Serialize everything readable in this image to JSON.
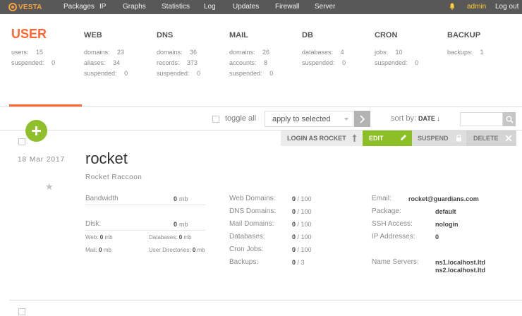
{
  "nav": {
    "brand": "VESTA",
    "items": [
      "Packages",
      "IP",
      "Graphs",
      "Statistics",
      "Log",
      "Updates",
      "Firewall",
      "Server"
    ],
    "user": "admin",
    "logout": "Log out"
  },
  "summary": {
    "user": {
      "title": "USER",
      "stats": [
        [
          "users:",
          "15"
        ],
        [
          "suspended:",
          "0"
        ]
      ]
    },
    "web": {
      "title": "WEB",
      "stats": [
        [
          "domains:",
          "23"
        ],
        [
          "aliases:",
          "34"
        ],
        [
          "suspended:",
          "0"
        ]
      ]
    },
    "dns": {
      "title": "DNS",
      "stats": [
        [
          "domains:",
          "36"
        ],
        [
          "records:",
          "373"
        ],
        [
          "suspended:",
          "0"
        ]
      ]
    },
    "mail": {
      "title": "MAIL",
      "stats": [
        [
          "domains:",
          "26"
        ],
        [
          "accounts:",
          "8"
        ],
        [
          "suspended:",
          "0"
        ]
      ]
    },
    "db": {
      "title": "DB",
      "stats": [
        [
          "databases:",
          "4"
        ],
        [
          "suspended:",
          "0"
        ]
      ]
    },
    "cron": {
      "title": "CRON",
      "stats": [
        [
          "jobs:",
          "10"
        ],
        [
          "suspended:",
          "0"
        ]
      ]
    },
    "backup": {
      "title": "BACKUP",
      "stats": [
        [
          "backups:",
          "1"
        ]
      ]
    }
  },
  "toolbar": {
    "toggle_all": "toggle all",
    "apply_selected": "apply to selected",
    "sort_by": "sort by:",
    "sort_value": "DATE ↓",
    "search_placeholder": ""
  },
  "actions": {
    "login_as": "LOGIN AS ROCKET",
    "edit": "EDIT",
    "suspend": "SUSPEND",
    "delete": "DELETE"
  },
  "record": {
    "date": "18 Mar 2017",
    "username": "rocket",
    "fullname": "Rocket Raccoon",
    "bandwidth_label": "Bandwidth",
    "bandwidth_value": "0",
    "bandwidth_unit": "mb",
    "disk_label": "Disk:",
    "disk_value": "0",
    "disk_unit": "mb",
    "web_label": "Web:",
    "web_value": "0",
    "web_unit": "mb",
    "databases_label": "Databases:",
    "databases_value": "0",
    "databases_unit": "mb",
    "mail_label": "Mail:",
    "mail_value": "0",
    "mail_unit": "mb",
    "userdirs_label": "User Directories:",
    "userdirs_value": "0",
    "userdirs_unit": "mb",
    "usage": [
      {
        "label": "Web Domains:",
        "used": "0",
        "limit": "/ 100"
      },
      {
        "label": "DNS Domains:",
        "used": "0",
        "limit": "/ 100"
      },
      {
        "label": "Mail Domains:",
        "used": "0",
        "limit": "/ 100"
      },
      {
        "label": "Databases:",
        "used": "0",
        "limit": "/ 100"
      },
      {
        "label": "Cron Jobs:",
        "used": "0",
        "limit": "/ 100"
      },
      {
        "label": "Backups:",
        "used": "0",
        "limit": "/ 3"
      }
    ],
    "info": [
      {
        "label": "Email:",
        "value": "rocket@guardians.com"
      },
      {
        "label": "Package:",
        "value": "default"
      },
      {
        "label": "SSH Access:",
        "value": "nologin"
      },
      {
        "label": "IP Addresses:",
        "value": "0"
      }
    ],
    "ns_label": "Name Servers:",
    "ns1": "ns1.localhost.ltd",
    "ns2": "ns2.localhost.ltd"
  },
  "colors": {
    "accent": "#ff6633",
    "edit_green": "#8cbf26",
    "add_green": "#8fc02c",
    "nav_bg": "#585858",
    "brand": "#f7a23e",
    "user_yellow": "#ffcc33"
  }
}
